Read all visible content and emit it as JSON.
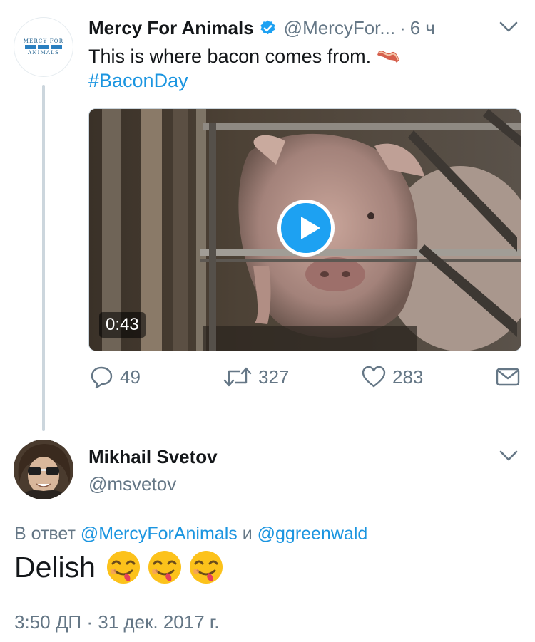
{
  "tweet": {
    "author_name": "Mercy For Animals",
    "handle": "@MercyFor...",
    "separator": "·",
    "time": "6 ч",
    "avatar_text_top": "MERCY FOR",
    "avatar_text_bottom": "ANIMALS",
    "text": "This is where bacon comes from.",
    "hashtag": "#BaconDay",
    "video_duration": "0:43",
    "counts": {
      "replies": "49",
      "retweets": "327",
      "likes": "283"
    }
  },
  "reply": {
    "author_name": "Mikhail Svetov",
    "handle": "@msvetov",
    "reply_prefix": "В ответ",
    "mention_1": "@MercyForAnimals",
    "conjunction": "и",
    "mention_2": "@ggreenwald",
    "text": "Delish",
    "timestamp": "3:50 ДП · 31 дек. 2017 г."
  },
  "colors": {
    "link": "#1b95e0",
    "secondary_text": "#657786",
    "verified_blue": "#1da1f2",
    "thread_line": "#ccd6dd"
  },
  "icons": [
    "verified-badge-icon",
    "chevron-down-icon",
    "bacon-emoji-icon",
    "play-icon",
    "reply-icon",
    "retweet-icon",
    "like-icon",
    "dm-icon",
    "yum-emoji-icon"
  ]
}
